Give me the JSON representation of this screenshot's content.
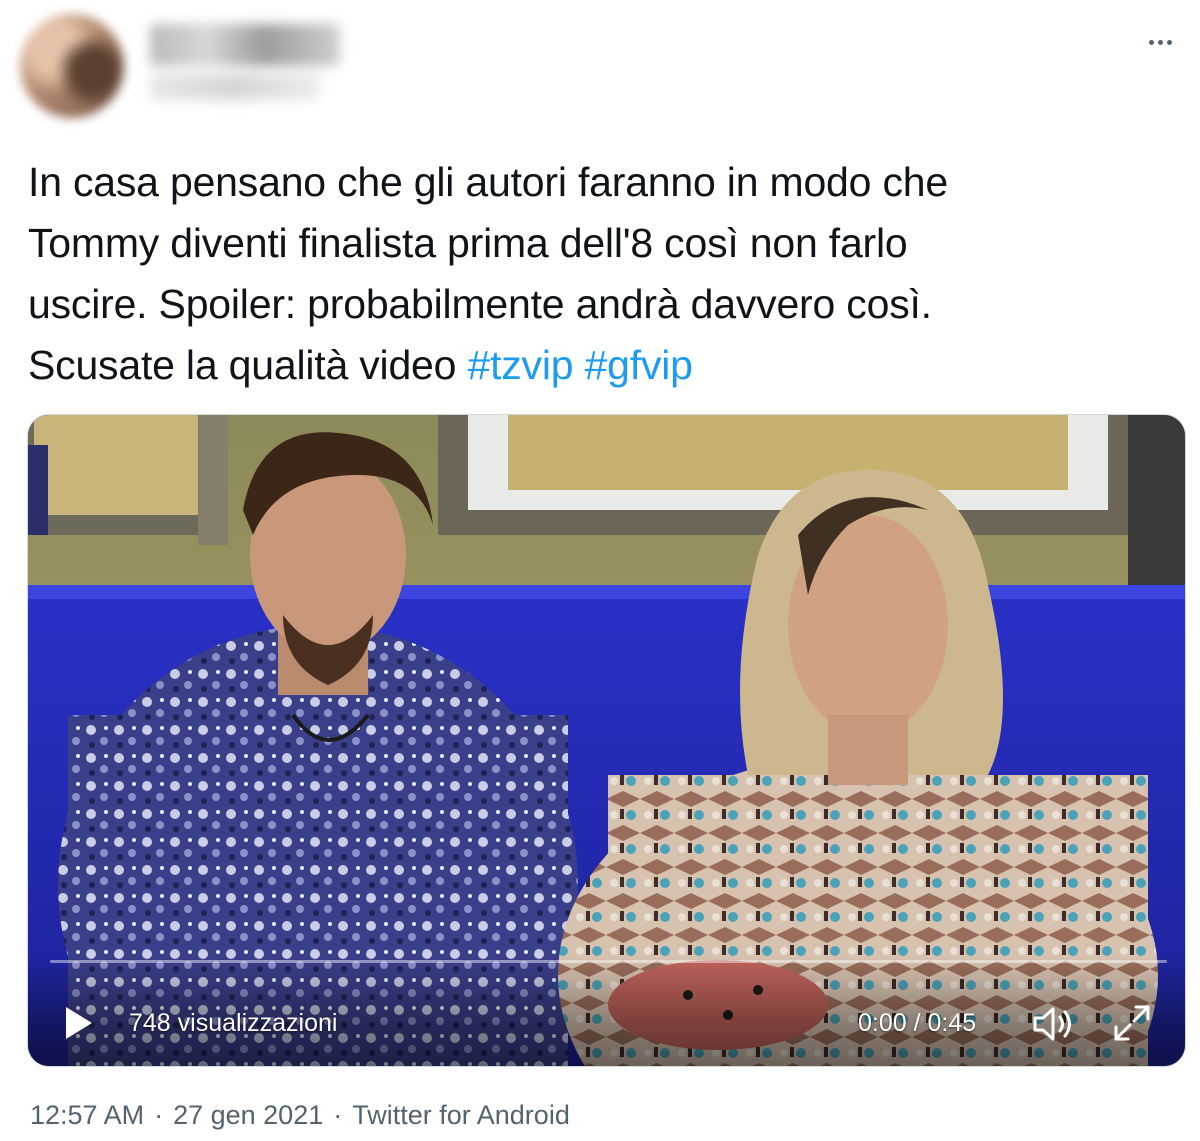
{
  "author": {
    "display_name": "██████",
    "handle": "██████"
  },
  "menu": {
    "more_icon": "more-horizontal-icon"
  },
  "tweet": {
    "text_lines": [
      "In casa pensano che gli autori faranno in modo che",
      "Tommy diventi finalista prima dell'8 così non farlo",
      "uscire. Spoiler: probabilmente andrà davvero così.",
      "Scusate la qualità video "
    ],
    "hashtags": [
      "#tzvip",
      "#gfvip"
    ],
    "hashtag_color": "#1d9bf0"
  },
  "video": {
    "views": "748 visualizzazioni",
    "time": "0:00 / 0:45",
    "progress_fraction": 0.0,
    "play_icon": "play-icon",
    "volume_icon": "volume-icon",
    "fullscreen_icon": "fullscreen-icon"
  },
  "meta": {
    "time": "12:57 AM",
    "date": "27 gen 2021",
    "source": "Twitter for Android",
    "separator": "·"
  }
}
